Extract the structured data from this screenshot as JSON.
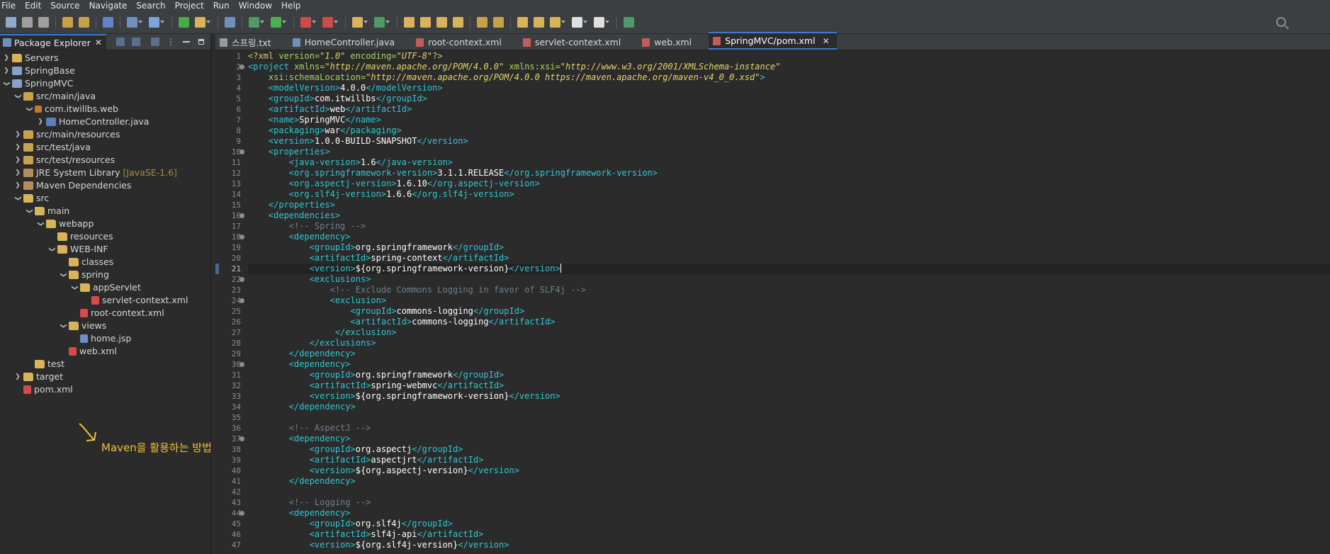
{
  "menu": [
    "File",
    "Edit",
    "Source",
    "Navigate",
    "Search",
    "Project",
    "Run",
    "Window",
    "Help"
  ],
  "explorer": {
    "tab_label": "Package Explorer",
    "close": "✕",
    "items": [
      {
        "label": "Servers",
        "indent": 0,
        "arrow": "right",
        "icon": "folder"
      },
      {
        "label": "SpringBase",
        "indent": 0,
        "arrow": "right",
        "icon": "proj"
      },
      {
        "label": "SpringMVC",
        "indent": 0,
        "arrow": "down",
        "icon": "proj"
      },
      {
        "label": "src/main/java",
        "indent": 1,
        "arrow": "down",
        "icon": "pkgf"
      },
      {
        "label": "com.itwillbs.web",
        "indent": 2,
        "arrow": "down",
        "icon": "pkg"
      },
      {
        "label": "HomeController.java",
        "indent": 3,
        "arrow": "right",
        "icon": "java"
      },
      {
        "label": "src/main/resources",
        "indent": 1,
        "arrow": "right",
        "icon": "pkgf"
      },
      {
        "label": "src/test/java",
        "indent": 1,
        "arrow": "right",
        "icon": "pkgf"
      },
      {
        "label": "src/test/resources",
        "indent": 1,
        "arrow": "right",
        "icon": "pkgf"
      },
      {
        "label": "JRE System Library",
        "deco": "[JavaSE-1.6]",
        "indent": 1,
        "arrow": "right",
        "icon": "lib"
      },
      {
        "label": "Maven Dependencies",
        "indent": 1,
        "arrow": "right",
        "icon": "lib"
      },
      {
        "label": "src",
        "indent": 1,
        "arrow": "down",
        "icon": "folder"
      },
      {
        "label": "main",
        "indent": 2,
        "arrow": "down",
        "icon": "folder"
      },
      {
        "label": "webapp",
        "indent": 3,
        "arrow": "down",
        "icon": "folder"
      },
      {
        "label": "resources",
        "indent": 4,
        "arrow": "",
        "icon": "folder"
      },
      {
        "label": "WEB-INF",
        "indent": 4,
        "arrow": "down",
        "icon": "folder"
      },
      {
        "label": "classes",
        "indent": 5,
        "arrow": "",
        "icon": "folder"
      },
      {
        "label": "spring",
        "indent": 5,
        "arrow": "down",
        "icon": "folder"
      },
      {
        "label": "appServlet",
        "indent": 6,
        "arrow": "down",
        "icon": "folder"
      },
      {
        "label": "servlet-context.xml",
        "indent": 7,
        "arrow": "",
        "icon": "xml"
      },
      {
        "label": "root-context.xml",
        "indent": 6,
        "arrow": "",
        "icon": "xml"
      },
      {
        "label": "views",
        "indent": 5,
        "arrow": "down",
        "icon": "folder"
      },
      {
        "label": "home.jsp",
        "indent": 6,
        "arrow": "",
        "icon": "jsp"
      },
      {
        "label": "web.xml",
        "indent": 5,
        "arrow": "",
        "icon": "xml"
      },
      {
        "label": "test",
        "indent": 2,
        "arrow": "",
        "icon": "folder"
      },
      {
        "label": "target",
        "indent": 1,
        "arrow": "right",
        "icon": "folder"
      },
      {
        "label": "pom.xml",
        "indent": 1,
        "arrow": "",
        "icon": "xml"
      }
    ]
  },
  "annotation": {
    "text": "Maven을 활용하는 방법",
    "color": "#f0c23a"
  },
  "editor": {
    "tabs": [
      {
        "label": "스프링.txt",
        "icon": "t",
        "active": false
      },
      {
        "label": "HomeController.java",
        "icon": "j",
        "active": false
      },
      {
        "label": "root-context.xml",
        "icon": "x",
        "active": false
      },
      {
        "label": "servlet-context.xml",
        "icon": "x",
        "active": false
      },
      {
        "label": "web.xml",
        "icon": "x",
        "active": false
      },
      {
        "label": "SpringMVC/pom.xml",
        "icon": "x",
        "active": true
      }
    ],
    "tab_close": "✕",
    "current_line": 21,
    "fold_lines": [
      2,
      10,
      16,
      18,
      22,
      24,
      30,
      37,
      44
    ],
    "lines": [
      "<?xml version=\"1.0\" encoding=\"UTF-8\"?>",
      "<project xmlns=\"http://maven.apache.org/POM/4.0.0\" xmlns:xsi=\"http://www.w3.org/2001/XMLSchema-instance\"",
      "    xsi:schemaLocation=\"http://maven.apache.org/POM/4.0.0 https://maven.apache.org/maven-v4_0_0.xsd\">",
      "    <modelVersion>4.0.0</modelVersion>",
      "    <groupId>com.itwillbs</groupId>",
      "    <artifactId>web</artifactId>",
      "    <name>SpringMVC</name>",
      "    <packaging>war</packaging>",
      "    <version>1.0.0-BUILD-SNAPSHOT</version>",
      "    <properties>",
      "        <java-version>1.6</java-version>",
      "        <org.springframework-version>3.1.1.RELEASE</org.springframework-version>",
      "        <org.aspectj-version>1.6.10</org.aspectj-version>",
      "        <org.slf4j-version>1.6.6</org.slf4j-version>",
      "    </properties>",
      "    <dependencies>",
      "        <!-- Spring -->",
      "        <dependency>",
      "            <groupId>org.springframework</groupId>",
      "            <artifactId>spring-context</artifactId>",
      "            <version>${org.springframework-version}</version>",
      "            <exclusions>",
      "                <!-- Exclude Commons Logging in favor of SLF4j -->",
      "                <exclusion>",
      "                    <groupId>commons-logging</groupId>",
      "                    <artifactId>commons-logging</artifactId>",
      "                 </exclusion>",
      "            </exclusions>",
      "        </dependency>",
      "        <dependency>",
      "            <groupId>org.springframework</groupId>",
      "            <artifactId>spring-webmvc</artifactId>",
      "            <version>${org.springframework-version}</version>",
      "        </dependency>",
      "",
      "        <!-- AspectJ -->",
      "        <dependency>",
      "            <groupId>org.aspectj</groupId>",
      "            <artifactId>aspectjrt</artifactId>",
      "            <version>${org.aspectj-version}</version>",
      "        </dependency>",
      "",
      "        <!-- Logging -->",
      "        <dependency>",
      "            <groupId>org.slf4j</groupId>",
      "            <artifactId>slf4j-api</artifactId>",
      "            <version>${org.slf4j-version}</version>"
    ]
  }
}
